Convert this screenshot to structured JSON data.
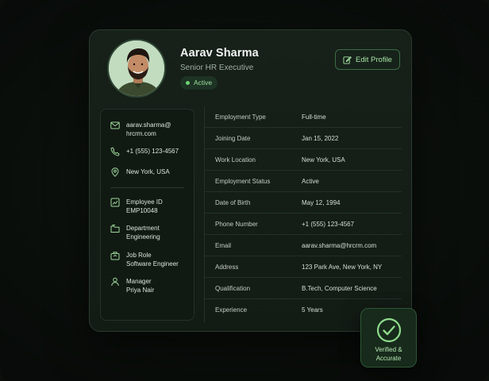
{
  "profile": {
    "name": "Aarav Sharma",
    "role": "Senior HR Executive",
    "status": "Active",
    "edit_label": "Edit Profile"
  },
  "contact": {
    "email_line1": "aarav.sharma@",
    "email_line2": "hrcrm.com",
    "phone": "+1 (555) 123-4567",
    "location": "New York, USA"
  },
  "info": [
    {
      "label": "Employee ID",
      "value": "EMP10048",
      "icon": "id-card-icon"
    },
    {
      "label": "Department",
      "value": "Engineering",
      "icon": "folder-icon"
    },
    {
      "label": "Job Role",
      "value": "Software Engineer",
      "icon": "briefcase-icon"
    },
    {
      "label": "Manager",
      "value": "Priya Nair",
      "icon": "user-icon"
    }
  ],
  "details": [
    {
      "label": "Employment Type",
      "value": "Full-time"
    },
    {
      "label": "Joining Date",
      "value": "Jan 15, 2022"
    },
    {
      "label": "Work Location",
      "value": "New York, USA"
    },
    {
      "label": "Employment Status",
      "value": "Active"
    },
    {
      "label": "Date of Birth",
      "value": "May 12, 1994"
    },
    {
      "label": "Phone Number",
      "value": "+1 (555) 123-4567"
    },
    {
      "label": "Email",
      "value": "aarav.sharma@hrcrm.com"
    },
    {
      "label": "Address",
      "value": "123 Park Ave, New York, NY"
    },
    {
      "label": "Qualification",
      "value": "B.Tech, Computer Science"
    },
    {
      "label": "Experience",
      "value": "5 Years"
    }
  ],
  "verified": {
    "line1": "Verified &",
    "line2": "Accurate"
  },
  "colors": {
    "accent": "#8fd98c",
    "card_bg": "#172019",
    "page_bg": "#0a0f0b"
  }
}
